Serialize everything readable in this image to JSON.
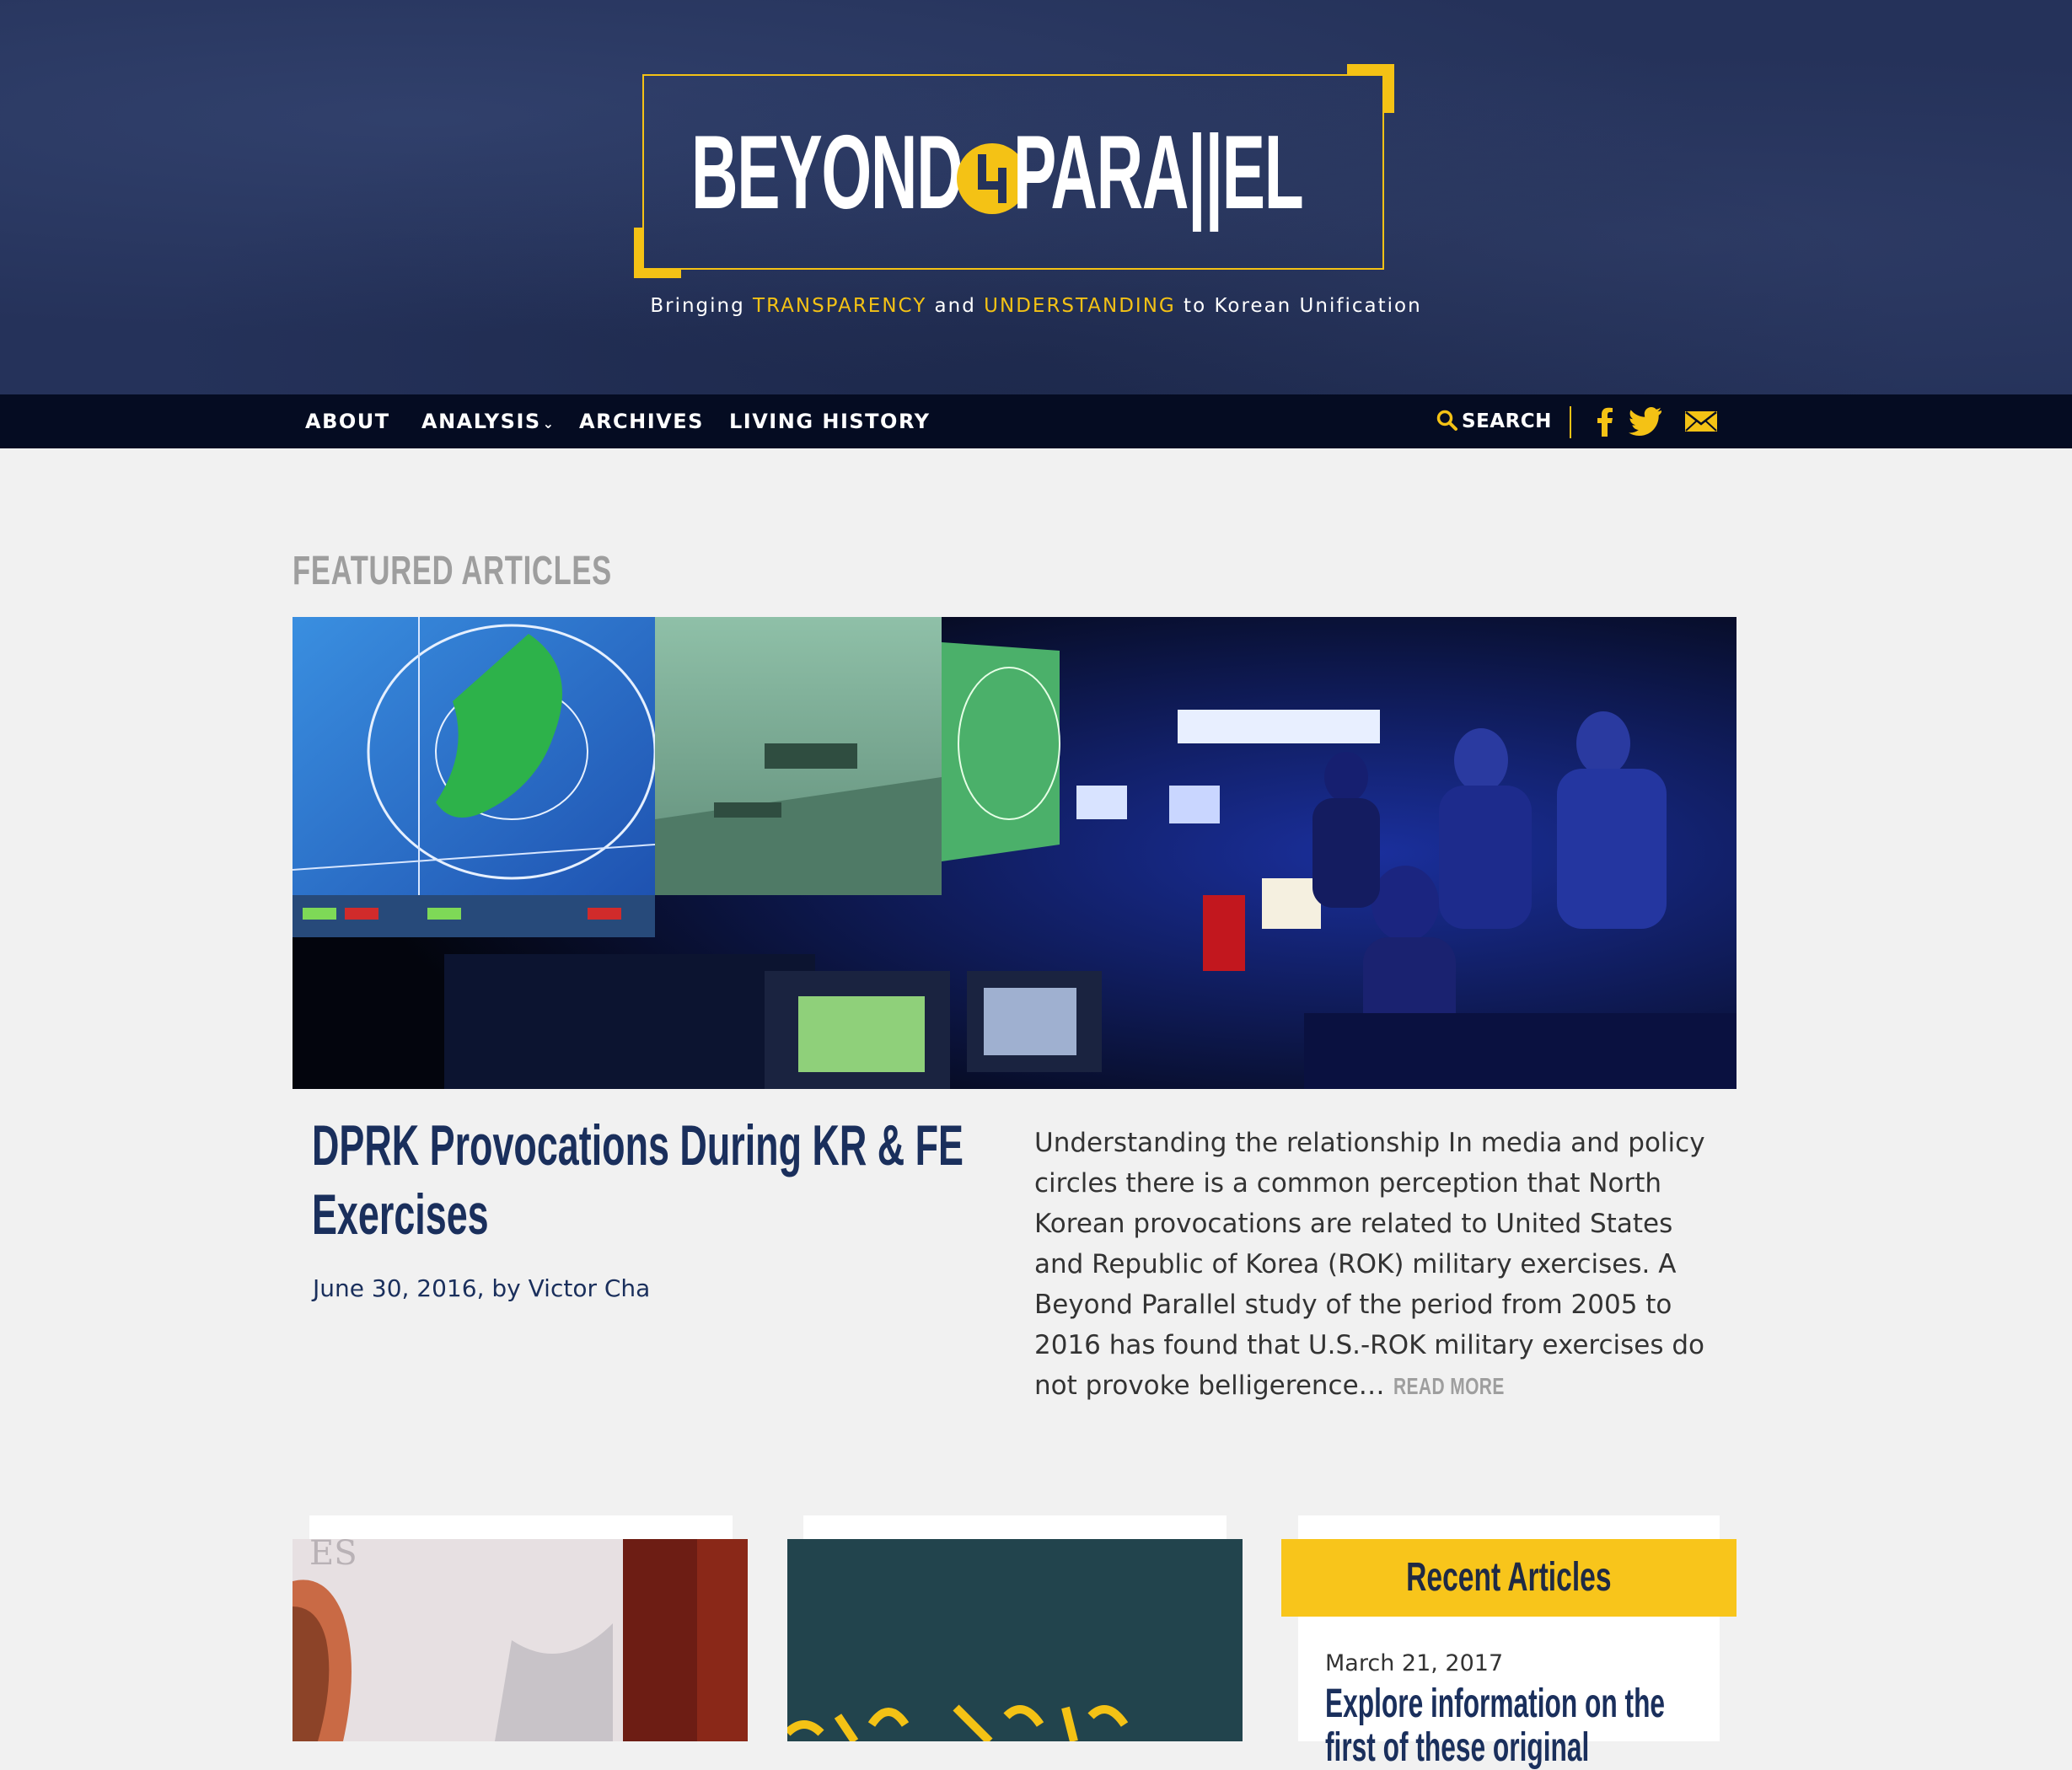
{
  "header": {
    "logo_left": "BEYOND",
    "logo_right": "PARA||EL",
    "tagline_prefix": "Bringing ",
    "tagline_hl1": "TRANSPARENCY",
    "tagline_mid": " and ",
    "tagline_hl2": "UNDERSTANDING",
    "tagline_suffix": " to Korean Unification"
  },
  "nav": {
    "items": [
      {
        "label": "ABOUT"
      },
      {
        "label": "ANALYSIS"
      },
      {
        "label": "ARCHIVES"
      },
      {
        "label": "LIVING HISTORY"
      }
    ],
    "search_label": "SEARCH",
    "social_icons": [
      "facebook-icon",
      "twitter-icon",
      "mail-icon"
    ]
  },
  "featured": {
    "heading": "FEATURED ARTICLES",
    "title": "DPRK Provocations During KR & FE Exercises",
    "date": "June 30, 2016",
    "by": ", by ",
    "author": "Victor Cha",
    "excerpt": "Understanding the relationship In media and policy circles there is a common perception that North Korean provocations are related to United States and Republic of Korea (ROK) military exercises. A Beyond Parallel study of the period from 2005 to 2016 has found that U.S.-ROK military exercises do not provoke belligerence…",
    "read_more": "READ MORE"
  },
  "sidebar": {
    "heading": "Recent Articles",
    "date": "March 21, 2017",
    "title": "Explore information on the first of these original"
  },
  "colors": {
    "accent": "#f4c215",
    "navy": "#1a2f5c",
    "nav_bg": "#050c22",
    "header_bg": "#25325a",
    "page_bg": "#f1f1f1"
  }
}
